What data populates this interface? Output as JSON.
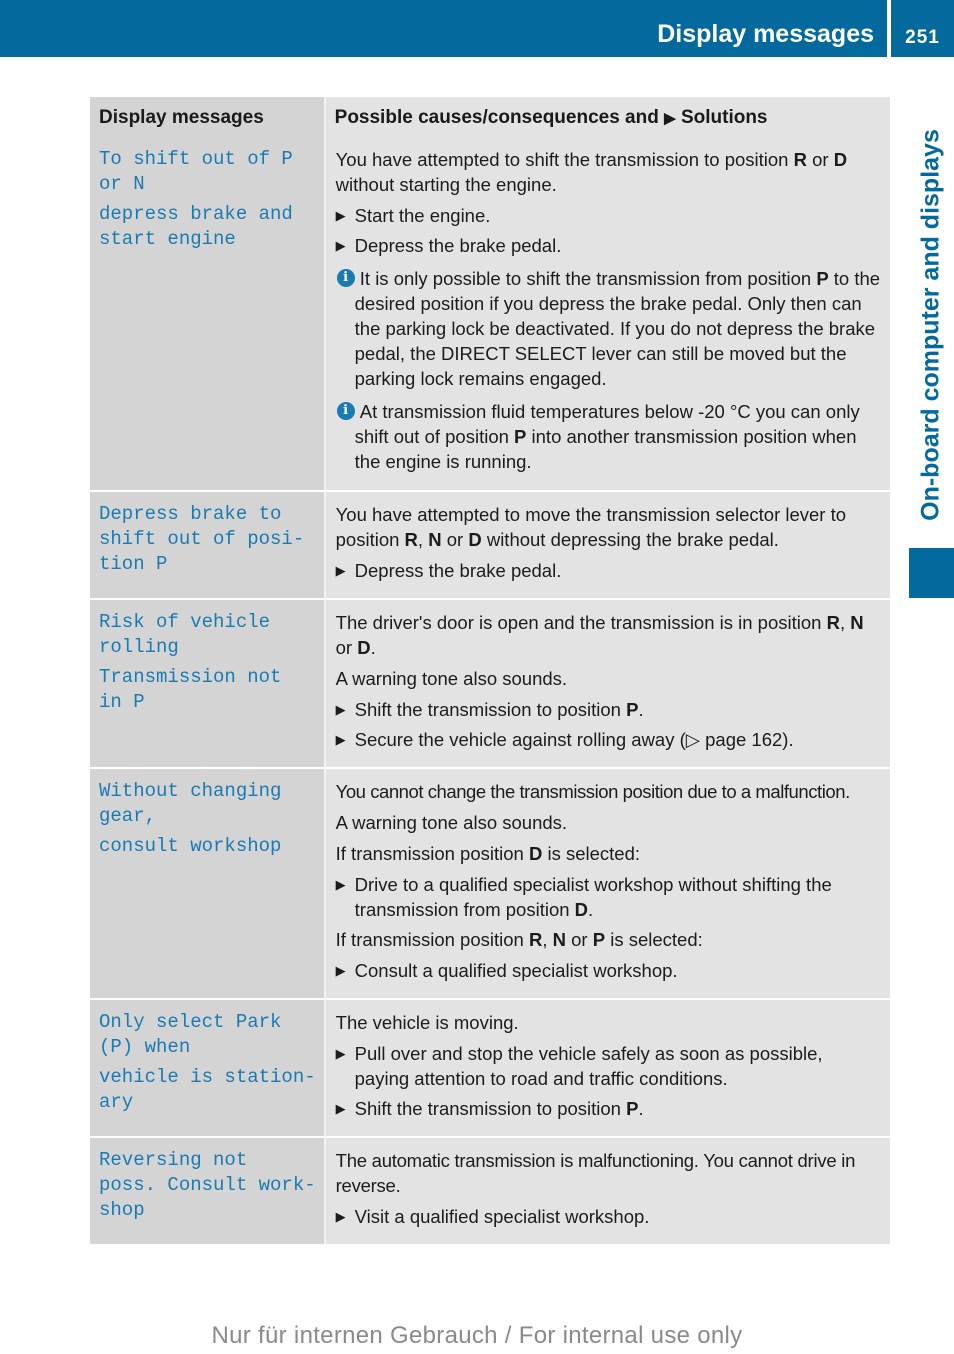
{
  "header": {
    "section_title": "Display messages",
    "page_number": "251"
  },
  "side_tab": {
    "label": "On-board computer and displays",
    "accent_color": "#046a9e"
  },
  "table": {
    "headers": {
      "col1": "Display messages",
      "col2_prefix": "Possible causes/consequences and ",
      "col2_arrow_icon": "▶",
      "col2_suffix": " Solutions"
    },
    "rows": [
      {
        "message_lines": [
          "To shift out of P\nor N",
          "depress brake and\nstart engine"
        ],
        "content": [
          {
            "type": "para",
            "html": "You have attempted to shift the transmission to position <b>R</b> or <b>D</b> without starting the engine."
          },
          {
            "type": "step",
            "html": "Start the engine."
          },
          {
            "type": "step",
            "html": "Depress the brake pedal."
          },
          {
            "type": "note",
            "html": "It is only possible to shift the transmission from position <b>P</b> to the desired position if you depress the brake pedal. Only then can the parking lock be deactivated. If you do not depress the brake pedal, the DIRECT SELECT lever can still be moved but the parking lock remains engaged."
          },
          {
            "type": "note",
            "html": "At transmission fluid temperatures below -20 °C you can only shift out of position <b>P</b> into another transmission position when the engine is running."
          }
        ]
      },
      {
        "message_lines": [
          "Depress brake to\nshift out of posi‐\ntion P"
        ],
        "content": [
          {
            "type": "para",
            "html": "You have attempted to move the transmission selector lever to position <b>R</b>, <b>N</b> or <b>D</b> without depressing the brake pedal."
          },
          {
            "type": "step",
            "html": "Depress the brake pedal."
          }
        ]
      },
      {
        "message_lines": [
          "Risk of vehicle\nrolling",
          "Transmission not\nin P"
        ],
        "content": [
          {
            "type": "para",
            "html": "The driver's door is open and the transmission is in position <b>R</b>, <b>N</b> or <b>D</b>."
          },
          {
            "type": "para",
            "html": "A warning tone also sounds."
          },
          {
            "type": "step",
            "html": "Shift the transmission to position <b>P</b>."
          },
          {
            "type": "step",
            "html": "Secure the vehicle against rolling away (▷ page 162)."
          }
        ]
      },
      {
        "message_lines": [
          "Without changing\ngear,",
          "consult workshop"
        ],
        "content": [
          {
            "type": "para",
            "html": "<span style=\"letter-spacing:-0.45px\">You cannot change the transmission position due to a malfunction.</span>"
          },
          {
            "type": "para",
            "html": "A warning tone also sounds."
          },
          {
            "type": "para",
            "html": "If transmission position <b>D</b> is selected:"
          },
          {
            "type": "step",
            "html": "Drive to a qualified specialist workshop without shifting the transmission from position <b>D</b>."
          },
          {
            "type": "para",
            "html": "If transmission position <b>R</b>, <b>N</b> or <b>P</b> is selected:"
          },
          {
            "type": "step",
            "html": "Consult a qualified specialist workshop."
          }
        ]
      },
      {
        "message_lines": [
          "Only select Park\n(P) when",
          "vehicle is station‐\nary"
        ],
        "content": [
          {
            "type": "para",
            "html": "The vehicle is moving."
          },
          {
            "type": "step",
            "html": "Pull over and stop the vehicle safely as soon as possible, paying attention to road and traffic conditions."
          },
          {
            "type": "step",
            "html": "Shift the transmission to position <b>P</b>."
          }
        ]
      },
      {
        "message_lines": [
          "Reversing not\nposs. Consult work‐\nshop"
        ],
        "content": [
          {
            "type": "para",
            "html": "<span style=\"letter-spacing:-0.25px\">The automatic transmission is malfunctioning. You cannot drive in reverse.</span>"
          },
          {
            "type": "step",
            "html": "Visit a qualified specialist workshop."
          }
        ]
      }
    ]
  },
  "icons": {
    "step_arrow": "▶",
    "info": "i"
  },
  "footer": {
    "watermark": "Nur für internen Gebrauch / For internal use only"
  }
}
